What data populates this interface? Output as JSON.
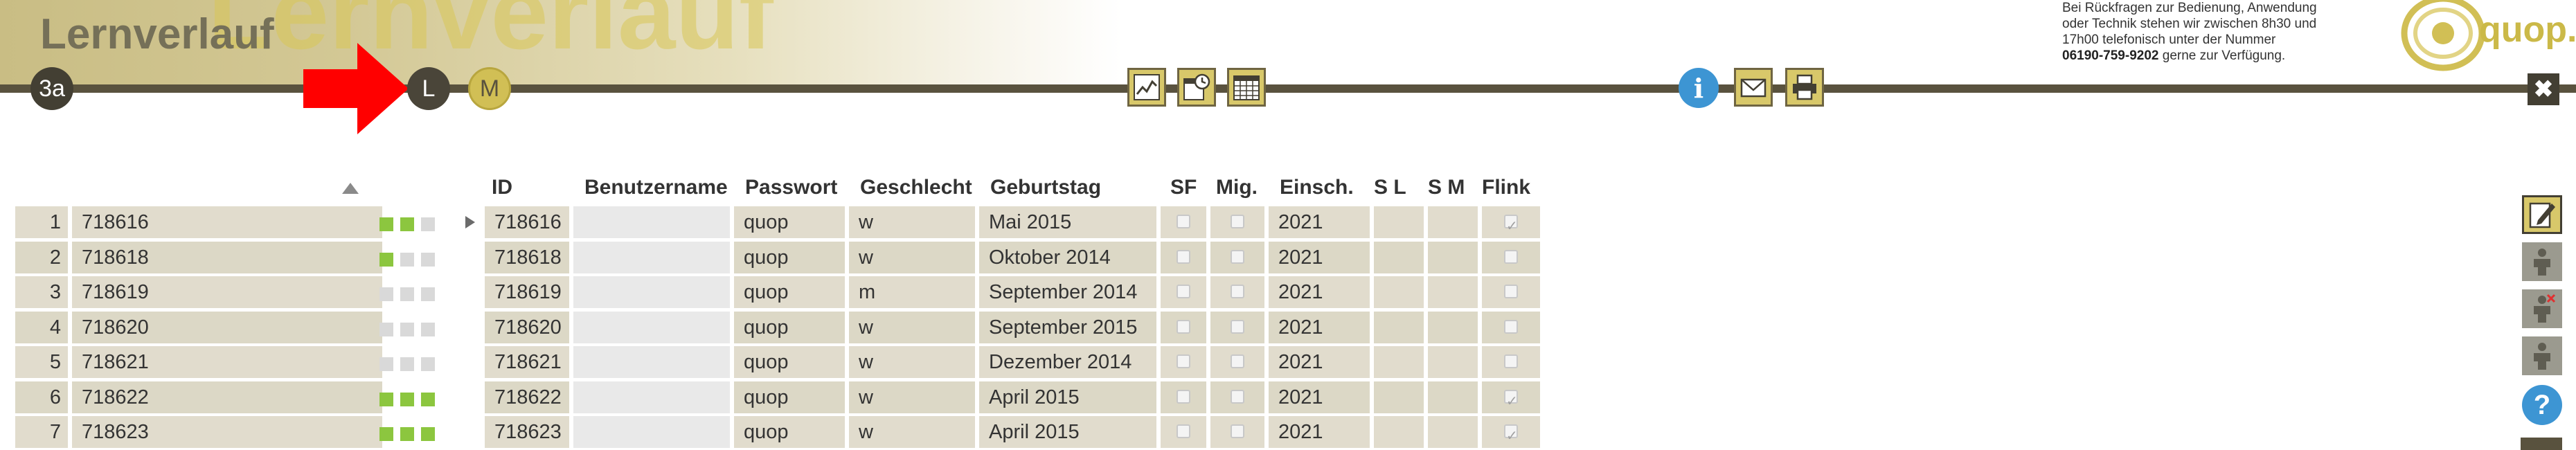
{
  "header": {
    "watermark": "Lernverlauf",
    "title": "Lernverlauf",
    "class_badge": "3a",
    "mode_l": "L",
    "mode_m": "M",
    "info_label": "i",
    "close_label": "✖",
    "contact_line1": "Bei Rückfragen zur Bedienung, Anwendung",
    "contact_line2": "oder Technik stehen wir zwischen 8h30 und",
    "contact_line3": "17h00 telefonisch unter der Nummer",
    "contact_phone": "06190-759-9202",
    "contact_line4": " gerne zur Verfügung.",
    "logo_text": "quop.",
    "icons": [
      "line-chart-icon",
      "calendar-clock-icon",
      "calendar-grid-icon",
      "info-icon",
      "mail-icon",
      "print-icon",
      "close-icon"
    ]
  },
  "table": {
    "columns": [
      "ID",
      "Benutzername",
      "Passwort",
      "Geschlecht",
      "Geburtstag",
      "SF",
      "Mig.",
      "Einsch.",
      "S L",
      "S M",
      "Flink"
    ],
    "rows": [
      {
        "nr": "1",
        "name": "718616",
        "progress": [
          1,
          1,
          0
        ],
        "id": "718616",
        "user": "",
        "pw": "quop",
        "sex": "w",
        "birth": "Mai 2015",
        "sf": false,
        "mig": false,
        "einsch": "2021",
        "flink": true
      },
      {
        "nr": "2",
        "name": "718618",
        "progress": [
          1,
          0,
          0
        ],
        "id": "718618",
        "user": "",
        "pw": "quop",
        "sex": "w",
        "birth": "Oktober 2014",
        "sf": false,
        "mig": false,
        "einsch": "2021",
        "flink": false
      },
      {
        "nr": "3",
        "name": "718619",
        "progress": [
          0,
          0,
          0
        ],
        "id": "718619",
        "user": "",
        "pw": "quop",
        "sex": "m",
        "birth": "September 2014",
        "sf": false,
        "mig": false,
        "einsch": "2021",
        "flink": false
      },
      {
        "nr": "4",
        "name": "718620",
        "progress": [
          0,
          0,
          0
        ],
        "id": "718620",
        "user": "",
        "pw": "quop",
        "sex": "w",
        "birth": "September 2015",
        "sf": false,
        "mig": false,
        "einsch": "2021",
        "flink": false
      },
      {
        "nr": "5",
        "name": "718621",
        "progress": [
          0,
          0,
          0
        ],
        "id": "718621",
        "user": "",
        "pw": "quop",
        "sex": "w",
        "birth": "Dezember 2014",
        "sf": false,
        "mig": false,
        "einsch": "2021",
        "flink": false
      },
      {
        "nr": "6",
        "name": "718622",
        "progress": [
          1,
          1,
          1
        ],
        "id": "718622",
        "user": "",
        "pw": "quop",
        "sex": "w",
        "birth": "April 2015",
        "sf": false,
        "mig": false,
        "einsch": "2021",
        "flink": true
      },
      {
        "nr": "7",
        "name": "718623",
        "progress": [
          1,
          1,
          1
        ],
        "id": "718623",
        "user": "",
        "pw": "quop",
        "sex": "w",
        "birth": "April 2015",
        "sf": false,
        "mig": false,
        "einsch": "2021",
        "flink": true
      }
    ]
  },
  "sidebar": {
    "help_label": "?",
    "icons": [
      "edit-icon",
      "person-icon",
      "person-remove-icon",
      "person-icon",
      "help-icon"
    ]
  },
  "colors": {
    "accent_gold": "#d8c86a",
    "dark_olive": "#59523e",
    "progress_on": "#8cc63f",
    "info_blue": "#3d95d3",
    "arrow_red": "#ff0000"
  }
}
